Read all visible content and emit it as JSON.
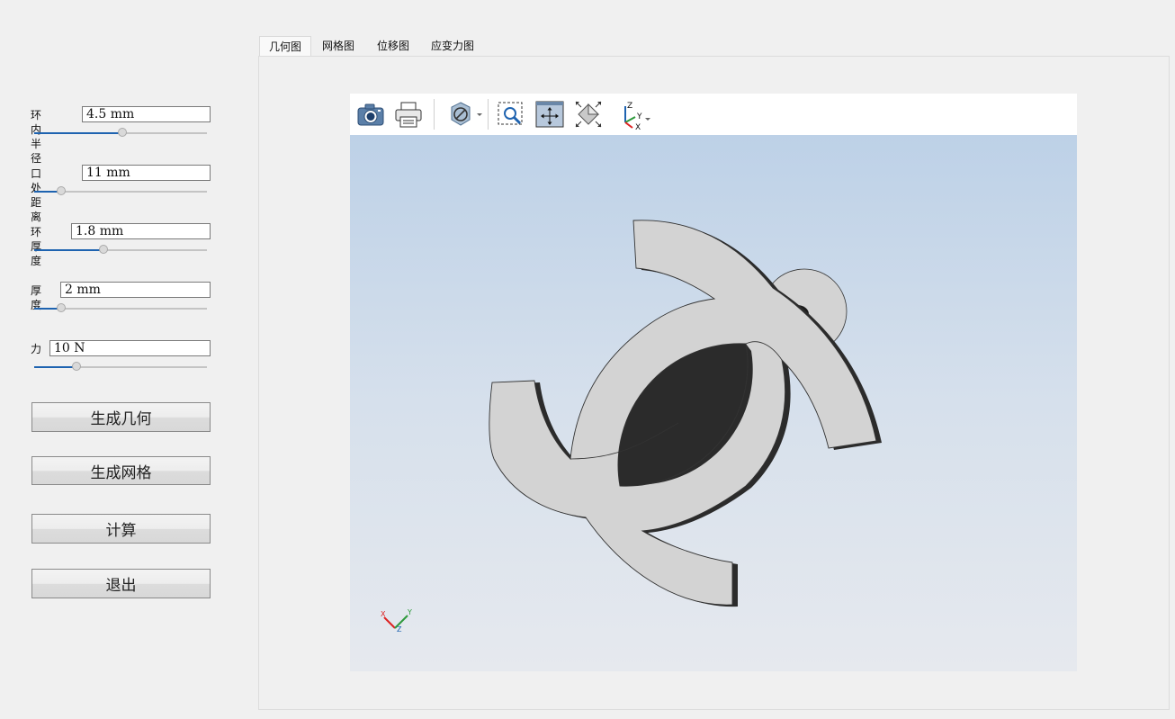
{
  "params": [
    {
      "label": "环内半径",
      "value": "4.5 mm"
    },
    {
      "label": "口处距离",
      "value": "11 mm"
    },
    {
      "label": "环厚度",
      "value": "1.8 mm"
    },
    {
      "label": "厚度",
      "value": "2 mm"
    },
    {
      "label": "力",
      "value": "10 N"
    }
  ],
  "sliders": {
    "inner_radius": 0.5,
    "opening_distance": 0.15,
    "ring_thickness": 0.4,
    "thickness": 0.15,
    "force": 0.24
  },
  "buttons": {
    "generate_geometry": "生成几何",
    "generate_mesh": "生成网格",
    "compute": "计算",
    "exit": "退出"
  },
  "tabs": [
    "几何图",
    "网格图",
    "位移图",
    "应变力图"
  ],
  "active_tab": "几何图",
  "toolbar": {
    "axis_labels": {
      "z": "Z",
      "y": "Y",
      "x": "X"
    }
  },
  "triad": {
    "x": "X",
    "y": "Y",
    "z": "Z"
  },
  "colors": {
    "accent": "#1e63b0",
    "viewport_top": "#bdd1e7",
    "viewport_bottom": "#e6e9ee",
    "part_face": "#d3d3d3",
    "part_side": "#2b2b2b"
  }
}
